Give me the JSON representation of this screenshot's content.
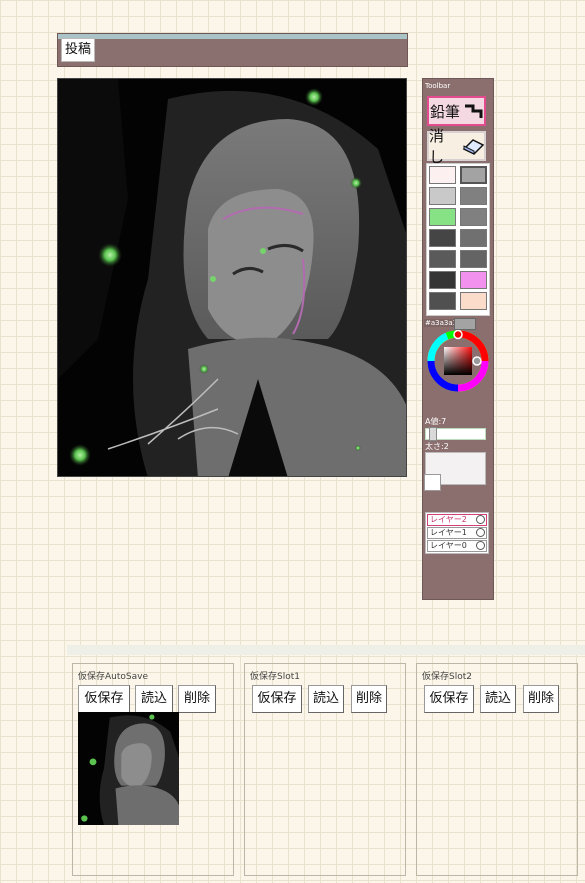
{
  "header": {
    "post_label": "投稿"
  },
  "toolbar": {
    "title": "Toolbar",
    "pencil_label": "鉛筆",
    "eraser_label": "消し",
    "palette": [
      {
        "color": "#fcf0f0",
        "selected": false
      },
      {
        "color": "#a3a3a3",
        "selected": true
      },
      {
        "color": "#c9c9c9",
        "selected": false
      },
      {
        "color": "#808080",
        "selected": false
      },
      {
        "color": "#86e285",
        "selected": false
      },
      {
        "color": "#808080",
        "selected": false
      },
      {
        "color": "#454545",
        "selected": false
      },
      {
        "color": "#707070",
        "selected": false
      },
      {
        "color": "#5a5a5a",
        "selected": false
      },
      {
        "color": "#646464",
        "selected": false
      },
      {
        "color": "#353535",
        "selected": false
      },
      {
        "color": "#f291ee",
        "selected": false
      },
      {
        "color": "#505050",
        "selected": false
      },
      {
        "color": "#fbdccb",
        "selected": false
      }
    ],
    "current_color": "#a3a3a3",
    "opacity_label": "A値:7",
    "opacity_value": 7,
    "size_label": "太さ:2",
    "size_value": 2,
    "layers": [
      {
        "name": "レイヤー2",
        "active": true
      },
      {
        "name": "レイヤー1",
        "active": false
      },
      {
        "name": "レイヤー0",
        "active": false
      }
    ]
  },
  "slots": [
    {
      "title": "仮保存AutoSave",
      "save_label": "仮保存",
      "load_label": "読込",
      "delete_label": "削除",
      "has_thumbnail": true
    },
    {
      "title": "仮保存Slot1",
      "save_label": "仮保存",
      "load_label": "読込",
      "delete_label": "削除",
      "has_thumbnail": false
    },
    {
      "title": "仮保存Slot2",
      "save_label": "仮保存",
      "load_label": "読込",
      "delete_label": "削除",
      "has_thumbnail": false
    }
  ],
  "accent_colors": {
    "toolbar_bg": "#8b6f6e",
    "active_layer": "#d0417a",
    "selected_tool": "#e44a8e"
  }
}
